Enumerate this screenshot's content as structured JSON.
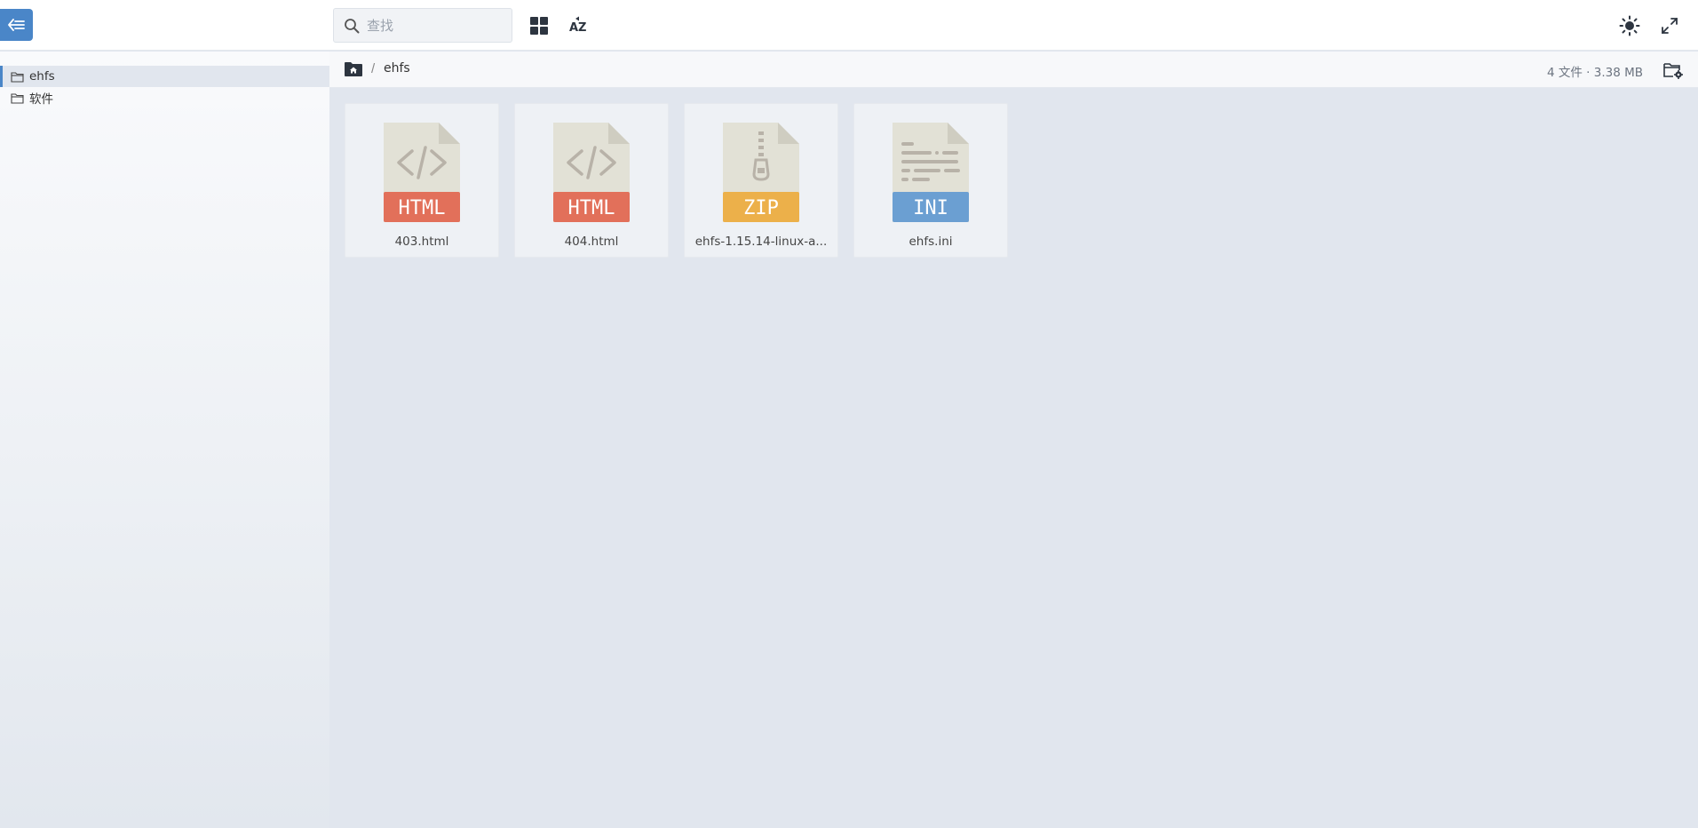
{
  "search": {
    "placeholder": "查找"
  },
  "toolbar": {
    "toggle_icon": "sidebar-collapse-icon",
    "view_icon": "grid-view-icon",
    "sort_label": "AZ",
    "theme_icon": "sun-icon",
    "fullscreen_icon": "expand-icon"
  },
  "sidebar": {
    "items": [
      {
        "label": "ehfs",
        "icon": "folder-icon",
        "active": true
      },
      {
        "label": "软件",
        "icon": "folder-icon",
        "active": false
      }
    ]
  },
  "breadcrumb": {
    "home_icon": "home-folder-icon",
    "separator": "/",
    "current": "ehfs"
  },
  "summary": "4 文件 · 3.38 MB",
  "files": [
    {
      "name": "403.html",
      "type_label": "HTML",
      "icon": "html-file-icon",
      "color": "#e2705a"
    },
    {
      "name": "404.html",
      "type_label": "HTML",
      "icon": "html-file-icon",
      "color": "#e2705a"
    },
    {
      "name": "ehfs-1.15.14-linux-a...",
      "type_label": "ZIP",
      "icon": "zip-file-icon",
      "color": "#ecb04a"
    },
    {
      "name": "ehfs.ini",
      "type_label": "INI",
      "icon": "ini-file-icon",
      "color": "#6b9fd2"
    }
  ]
}
